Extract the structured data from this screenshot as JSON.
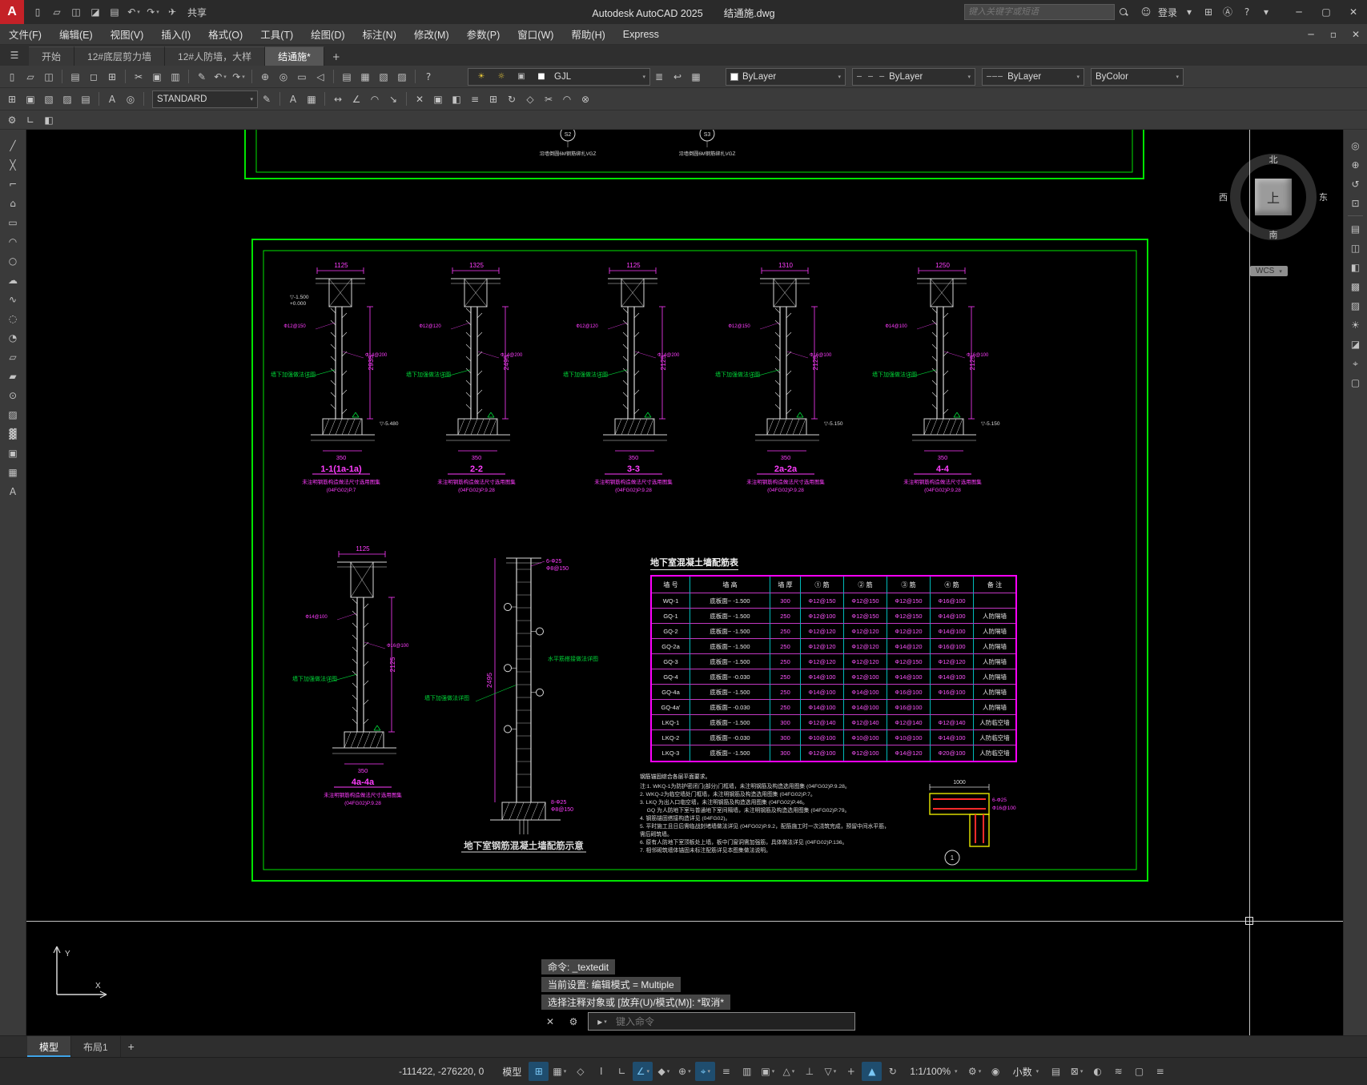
{
  "ui": {
    "caret": "▾"
  },
  "titlebar": {
    "logo": "A",
    "share_label": "共享",
    "title_app": "Autodesk AutoCAD 2025",
    "title_doc": "结通施.dwg",
    "search_placeholder": "键入关键字或短语"
  },
  "menubar": {
    "items": [
      "文件(F)",
      "编辑(E)",
      "视图(V)",
      "插入(I)",
      "格式(O)",
      "工具(T)",
      "绘图(D)",
      "标注(N)",
      "修改(M)",
      "参数(P)",
      "窗口(W)",
      "帮助(H)",
      "Express"
    ]
  },
  "filetabs": {
    "items": [
      {
        "label": "开始",
        "active": false
      },
      {
        "label": "12#底层剪力墙",
        "active": false
      },
      {
        "label": "12#人防墙，大样",
        "active": false
      },
      {
        "label": "结通施*",
        "active": true
      }
    ]
  },
  "ribbon": {
    "text_style": "STANDARD",
    "layer_name": "GJL",
    "color": "ByLayer",
    "linetype": "ByLayer",
    "linetype_sample": "– – –",
    "lineweight": "ByLayer",
    "lineweight_sample": "———",
    "plot_style": "ByColor"
  },
  "icons": {
    "qat": [
      {
        "n": "new-drawing-icon",
        "g": "▯"
      },
      {
        "n": "open-drawing-icon",
        "g": "▱"
      },
      {
        "n": "save-icon",
        "g": "◫"
      },
      {
        "n": "save-as-icon",
        "g": "◪"
      },
      {
        "n": "plot-icon",
        "g": "▤"
      },
      {
        "n": "undo-icon",
        "g": "↶",
        "caret": true
      },
      {
        "n": "redo-icon",
        "g": "↷",
        "caret": true
      },
      {
        "n": "share-icon",
        "g": "✈"
      }
    ],
    "titlebar_right": [
      {
        "n": "signin-user-icon",
        "g": "☺"
      },
      {
        "t": "登录",
        "n": "signin-label"
      },
      {
        "n": "signin-caret",
        "g": "▾"
      },
      {
        "n": "app-store-icon",
        "g": "⊞"
      },
      {
        "n": "autodesk-assistant-icon",
        "g": "Ⓐ"
      },
      {
        "n": "help-icon",
        "g": "?"
      },
      {
        "n": "help-caret",
        "g": "▾"
      }
    ],
    "window": [
      {
        "n": "minimize-button",
        "g": "─"
      },
      {
        "n": "maximize-button",
        "g": "▢"
      },
      {
        "n": "close-button",
        "g": "✕"
      }
    ],
    "docwindow": [
      {
        "n": "doc-minimize-button",
        "g": "─"
      },
      {
        "n": "doc-restore-button",
        "g": "▫"
      },
      {
        "n": "doc-close-button",
        "g": "✕"
      }
    ],
    "tabbar": [
      {
        "n": "menu-browser-icon",
        "g": "☰"
      }
    ],
    "tabplus": [
      {
        "n": "new-tab-button",
        "g": "+"
      }
    ],
    "row1a": [
      {
        "n": "qnew-icon",
        "g": "▯"
      },
      {
        "n": "open-icon",
        "g": "▱"
      },
      {
        "n": "save-icon",
        "g": "◫"
      },
      {
        "sep": 1
      },
      {
        "n": "plot-icon",
        "g": "▤"
      },
      {
        "n": "plot-preview-icon",
        "g": "◻"
      },
      {
        "n": "publish-icon",
        "g": "⊞"
      },
      {
        "sep": 1
      },
      {
        "n": "cut-icon",
        "g": "✂"
      },
      {
        "n": "copy-icon",
        "g": "▣"
      },
      {
        "n": "paste-icon",
        "g": "▥"
      },
      {
        "sep": 1
      },
      {
        "n": "match-properties-icon",
        "g": "✎"
      },
      {
        "n": "undo-icon",
        "g": "↶",
        "caret": true
      },
      {
        "n": "redo-icon",
        "g": "↷",
        "caret": true
      },
      {
        "sep": 1
      },
      {
        "n": "pan-icon",
        "g": "⊕"
      },
      {
        "n": "zoom-realtime-icon",
        "g": "◎"
      },
      {
        "n": "zoom-window-icon",
        "g": "▭"
      },
      {
        "n": "zoom-previous-icon",
        "g": "◁"
      },
      {
        "sep": 1
      },
      {
        "n": "properties-icon",
        "g": "▤"
      },
      {
        "n": "designcenter-icon",
        "g": "▦"
      },
      {
        "n": "tool-palettes-icon",
        "g": "▧"
      },
      {
        "n": "sheet-set-icon",
        "g": "▨"
      },
      {
        "sep": 1
      },
      {
        "n": "help-icon",
        "g": "?"
      }
    ],
    "layer_minis": [
      {
        "n": "layer-on-icon",
        "g": "☀",
        "c": "#e3c43a"
      },
      {
        "n": "layer-freeze-icon",
        "g": "☼",
        "c": "#e3c43a"
      },
      {
        "n": "layer-lock-icon",
        "g": "▣",
        "c": "#bdbdbd"
      },
      {
        "n": "layer-color-chip-icon",
        "g": "■",
        "c": "#ffffff"
      }
    ],
    "row1b": [
      {
        "n": "layer-properties-icon",
        "g": "≣"
      },
      {
        "n": "layer-previous-icon",
        "g": "↩"
      },
      {
        "n": "layer-states-icon",
        "g": "▦"
      }
    ],
    "row2a": [
      {
        "n": "insert-block-icon",
        "g": "⊞"
      },
      {
        "n": "block-editor-icon",
        "g": "▣"
      },
      {
        "n": "xref-icon",
        "g": "▧"
      },
      {
        "n": "image-attach-icon",
        "g": "▨"
      },
      {
        "n": "field-icon",
        "g": "▤"
      },
      {
        "sep": 1
      },
      {
        "n": "spell-check-icon",
        "g": "A"
      },
      {
        "n": "find-icon",
        "g": "◎"
      },
      {
        "sep": 1
      }
    ],
    "row2b": [
      {
        "n": "text-edit-icon",
        "g": "✎"
      },
      {
        "sep": 1
      },
      {
        "n": "mtext-icon",
        "g": "A"
      },
      {
        "n": "table-icon",
        "g": "▦"
      },
      {
        "sep": 1
      },
      {
        "n": "dim-linear-icon",
        "g": "↔"
      },
      {
        "n": "dim-angular-icon",
        "g": "∠"
      },
      {
        "n": "dim-radius-icon",
        "g": "◠"
      },
      {
        "n": "leader-icon",
        "g": "↘"
      },
      {
        "sep": 1
      },
      {
        "n": "erase-icon",
        "g": "✕"
      },
      {
        "n": "copy-object-icon",
        "g": "▣"
      },
      {
        "n": "mirror-icon",
        "g": "◧"
      },
      {
        "n": "offset-icon",
        "g": "≡"
      },
      {
        "n": "array-icon",
        "g": "⊞"
      },
      {
        "n": "rotate-icon",
        "g": "↻"
      },
      {
        "n": "scale-icon",
        "g": "◇"
      },
      {
        "n": "trim-icon",
        "g": "✂"
      },
      {
        "n": "fillet-icon",
        "g": "◠"
      },
      {
        "n": "explode-icon",
        "g": "⊗"
      }
    ],
    "row3": [
      {
        "n": "workspace-icon",
        "g": "⚙"
      },
      {
        "n": "ucs-toolbar-icon",
        "g": "∟"
      },
      {
        "n": "view-toolbar-icon",
        "g": "◧"
      }
    ],
    "left": [
      {
        "n": "line-icon",
        "g": "╱"
      },
      {
        "n": "construction-line-icon",
        "g": "╳"
      },
      {
        "n": "polyline-icon",
        "g": "⌐"
      },
      {
        "n": "polygon-icon",
        "g": "⌂"
      },
      {
        "n": "rectangle-icon",
        "g": "▭"
      },
      {
        "n": "arc-icon",
        "g": "◠"
      },
      {
        "n": "circle-icon",
        "g": "○"
      },
      {
        "n": "revision-cloud-icon",
        "g": "☁"
      },
      {
        "n": "spline-icon",
        "g": "∿"
      },
      {
        "n": "ellipse-icon",
        "g": "◌"
      },
      {
        "n": "ellipse-arc-icon",
        "g": "◔"
      },
      {
        "n": "insert-block-icon",
        "g": "▱"
      },
      {
        "n": "make-block-icon",
        "g": "▰"
      },
      {
        "n": "point-icon",
        "g": "⊙"
      },
      {
        "n": "hatch-icon",
        "g": "▨"
      },
      {
        "n": "gradient-icon",
        "g": "▓"
      },
      {
        "n": "region-icon",
        "g": "▣"
      },
      {
        "n": "table-icon",
        "g": "▦"
      },
      {
        "n": "multiline-text-icon",
        "g": "A"
      }
    ],
    "right": [
      {
        "n": "steering-wheel-icon",
        "g": "◎"
      },
      {
        "n": "pan-icon",
        "g": "⊕"
      },
      {
        "n": "orbit-icon",
        "g": "↺"
      },
      {
        "n": "zoom-extents-icon",
        "g": "⊡"
      },
      {
        "sep": 1
      },
      {
        "n": "layer-walk-icon",
        "g": "▤"
      },
      {
        "n": "named-views-icon",
        "g": "◫"
      },
      {
        "n": "visual-styles-icon",
        "g": "◧"
      },
      {
        "n": "render-icon",
        "g": "▩"
      },
      {
        "n": "materials-icon",
        "g": "▨"
      },
      {
        "n": "lights-icon",
        "g": "☀"
      },
      {
        "n": "section-plane-icon",
        "g": "◪"
      },
      {
        "n": "measure-icon",
        "g": "⌖"
      },
      {
        "n": "clean-screen-icon",
        "g": "▢"
      }
    ],
    "statusA": [
      {
        "n": "grid-icon",
        "g": "⊞",
        "active": true
      },
      {
        "n": "snap-icon",
        "g": "▦",
        "caret": true
      },
      {
        "n": "infer-constraints-icon",
        "g": "◇"
      },
      {
        "n": "dynamic-input-icon",
        "g": "I"
      },
      {
        "n": "ortho-icon",
        "g": "∟"
      },
      {
        "n": "polar-tracking-icon",
        "g": "∠",
        "caret": true,
        "active": true
      },
      {
        "n": "isodraft-icon",
        "g": "◆",
        "caret": true
      },
      {
        "n": "object-snap-tracking-icon",
        "g": "⊕",
        "caret": true
      },
      {
        "n": "object-snap-icon",
        "g": "⌖",
        "caret": true,
        "active": true
      },
      {
        "n": "lineweight-display-icon",
        "g": "≡"
      },
      {
        "n": "transparency-icon",
        "g": "▥"
      },
      {
        "n": "selection-cycling-icon",
        "g": "▣",
        "caret": true
      },
      {
        "n": "object-snap-3d-icon",
        "g": "△",
        "caret": true
      },
      {
        "n": "dynamic-ucs-icon",
        "g": "⊥"
      },
      {
        "n": "selection-filter-icon",
        "g": "▽",
        "caret": true
      },
      {
        "n": "gizmo-icon",
        "g": "+"
      },
      {
        "n": "annotation-visibility-icon",
        "g": "▲",
        "active": true
      },
      {
        "n": "autoscale-icon",
        "g": "↻"
      }
    ],
    "statusB": [
      {
        "n": "workspace-switch-icon",
        "g": "⚙",
        "caret": true
      },
      {
        "n": "annotation-monitor-icon",
        "g": "◉"
      }
    ],
    "statusC": [
      {
        "n": "quick-properties-icon",
        "g": "▤"
      },
      {
        "n": "lock-ui-icon",
        "g": "⊠",
        "caret": true
      },
      {
        "n": "isolate-objects-icon",
        "g": "◐"
      },
      {
        "n": "graphics-performance-icon",
        "g": "≋"
      },
      {
        "n": "clean-screen-icon",
        "g": "▢"
      },
      {
        "n": "customize-icon",
        "g": "≡"
      }
    ],
    "cmd": [
      {
        "n": "command-close-icon",
        "g": "✕"
      },
      {
        "n": "command-customize-icon",
        "g": "⚙"
      }
    ],
    "cmd_box": [
      {
        "n": "recent-commands-icon",
        "g": "▸",
        "caret": true
      }
    ]
  },
  "drawing": {
    "top_labels": [
      {
        "bubble": "S2",
        "text": "沿墙倒圆6M钢筋绑扎VGZ"
      },
      {
        "bubble": "S3",
        "text": "沿墙倒圆6M钢筋绑扎VGZ"
      }
    ],
    "sections": [
      {
        "label": "1-1(1a-1a)",
        "note1": "未注明钢筋构造做法尺寸选用图集",
        "note2": "(04FG02)P.7",
        "side_dim": "2935",
        "top_dim": "1125",
        "bot_dim": "350",
        "bar1": "Ф12@150",
        "bar2": "Ф14@200",
        "ann": "墙下加强做法详图",
        "lv_top": "-1.500",
        "lv_top2": "+0.000",
        "lv_bot": "-5.480"
      },
      {
        "label": "2-2",
        "note1": "未注明钢筋构造做法尺寸选用图集",
        "note2": "(04FG02)P.9.28",
        "side_dim": "2495",
        "top_dim": "1325",
        "bot_dim": "350",
        "bar1": "Ф12@120",
        "bar2": "Ф14@200",
        "ann": "墙下加强做法详图"
      },
      {
        "label": "3-3",
        "note1": "未注明钢筋构造做法尺寸选用图集",
        "note2": "(04FG02)P.9.28",
        "side_dim": "2125",
        "top_dim": "1125",
        "bot_dim": "350",
        "bar1": "Ф12@120",
        "bar2": "Ф14@200",
        "ann": "墙下加强做法详图"
      },
      {
        "label": "2a-2a",
        "note1": "未注明钢筋构造做法尺寸选用图集",
        "note2": "(04FG02)P.9.28",
        "side_dim": "2125",
        "top_dim": "1310",
        "bot_dim": "350",
        "bar1": "Ф12@150",
        "bar2": "Ф16@100",
        "ann": "墙下加强做法详图",
        "lv_bot": "-5.150"
      },
      {
        "label": "4-4",
        "note1": "未注明钢筋构造做法尺寸选用图集",
        "note2": "(04FG02)P.9.28",
        "side_dim": "2125",
        "top_dim": "1250",
        "bot_dim": "350",
        "bar1": "Ф14@100",
        "bar2": "Ф16@100",
        "ann": "墙下加强做法详图",
        "lv_bot": "-5.150"
      }
    ],
    "section_4a": {
      "label": "4a-4a",
      "note1": "未注明钢筋构造做法尺寸选用图集",
      "note2": "(04FG02)P.9.28",
      "side_dim": "2125",
      "top_dim": "1125",
      "bot_dim": "350",
      "bar1": "Ф14@100",
      "bar2": "Ф16@100",
      "ann": "墙下加强做法详图"
    },
    "elevation": {
      "title": "地下室钢筋混凝土墙配筋示意",
      "side_dim": "2495",
      "top_note": "6-Ф25",
      "top_note2": "Ф8@150",
      "bot_note": "8-Ф25",
      "bot_note2": "Ф8@150",
      "ann": "墙下加强做法详图",
      "ann2": "水平筋搭接做法详图"
    },
    "detail": {
      "dim": "1000",
      "bars": "6-Ф25",
      "stirrup": "Ф16@100",
      "bubble": "1"
    },
    "table": {
      "title": "地下室混凝土墙配筋表",
      "headers": [
        "墙 号",
        "墙    高",
        "墙 厚",
        "① 筋",
        "② 筋",
        "③ 筋",
        "④ 筋",
        "备  注"
      ],
      "rows": [
        [
          "WQ-1",
          "底板面~ -1.500",
          "300",
          "Ф12@150",
          "Ф12@150",
          "Ф12@150",
          "Ф16@100",
          ""
        ],
        [
          "GQ-1",
          "底板面~ -1.500",
          "250",
          "Ф12@100",
          "Ф12@150",
          "Ф12@150",
          "Ф14@100",
          "人防隔墙"
        ],
        [
          "GQ-2",
          "底板面~ -1.500",
          "250",
          "Ф12@120",
          "Ф12@120",
          "Ф12@120",
          "Ф14@100",
          "人防隔墙"
        ],
        [
          "GQ-2a",
          "底板面~ -1.500",
          "250",
          "Ф12@120",
          "Ф12@120",
          "Ф14@120",
          "Ф16@100",
          "人防隔墙"
        ],
        [
          "GQ-3",
          "底板面~ -1.500",
          "250",
          "Ф12@120",
          "Ф12@120",
          "Ф12@150",
          "Ф12@120",
          "人防隔墙"
        ],
        [
          "GQ-4",
          "底板面~ -0.030",
          "250",
          "Ф14@100",
          "Ф12@100",
          "Ф14@100",
          "Ф14@100",
          "人防隔墙"
        ],
        [
          "GQ-4a",
          "底板面~ -1.500",
          "250",
          "Ф14@100",
          "Ф14@100",
          "Ф16@100",
          "Ф16@100",
          "人防隔墙"
        ],
        [
          "GQ-4a'",
          "底板面~ -0.030",
          "250",
          "Ф14@100",
          "Ф14@100",
          "Ф16@100",
          "",
          "人防隔墙"
        ],
        [
          "LKQ-1",
          "底板面~ -1.500",
          "300",
          "Ф12@140",
          "Ф12@140",
          "Ф12@140",
          "Ф12@140",
          "人防临空墙"
        ],
        [
          "LKQ-2",
          "底板面~ -0.030",
          "300",
          "Ф10@100",
          "Ф10@100",
          "Ф10@100",
          "Ф14@100",
          "人防临空墙"
        ],
        [
          "LKQ-3",
          "底板面~ -1.500",
          "300",
          "Ф12@100",
          "Ф12@100",
          "Ф14@120",
          "Ф20@100",
          "人防临空墙"
        ]
      ]
    },
    "notes": {
      "heading": "钢筋锚固综合各层平面要求。",
      "items": [
        "注:1. WKQ-1为防护密闭门(部分)门框墙，未注明钢筋及构造选用图集 (04FG02)P.9.28。",
        "2. WKQ-2为临空墙处门框墙，未注明钢筋及构造选用图集 (04FG02)P.7。",
        "3. LKQ 为出入口临空墙，未注明钢筋及构造选用图集 (04FG02)P.46。",
        "　 GQ 为人防地下室与普通地下室间隔墙，未注明钢筋及构造选用图集 (04FG02)P.79。",
        "4. 钢筋锚固搭接构造详见 (04FG02)。",
        "5. 平时施工且日后需临战封堵墙做法详见 (04FG02)P.9.2，配筋施工时一次浇筑完成，预留中间水平筋，需后砌筑墙。",
        "6. 原有人防地下室顶板处上墙，板中门窗洞需加强筋，具体做法详见 (04FG02)P.136。",
        "7. 相邻砌筑墙体锚固未标注配筋详见本图集做法说明。"
      ]
    },
    "compass": {
      "north": "北",
      "south": "南",
      "east": "东",
      "west": "西",
      "up": "上",
      "wcs": "WCS"
    },
    "ucs": {
      "x": "X",
      "y": "Y"
    }
  },
  "command": {
    "lines": [
      "命令: _textedit",
      "当前设置: 编辑模式 = Multiple",
      "选择注释对象或 [放弃(U)/模式(M)]: *取消*"
    ],
    "input_placeholder": "键入命令"
  },
  "layout_tabs": {
    "items": [
      "模型",
      "布局1"
    ]
  },
  "statusbar": {
    "coords": "-111422, -276220, 0",
    "model": "模型",
    "scale": "1:1/100%",
    "units": "小数"
  }
}
